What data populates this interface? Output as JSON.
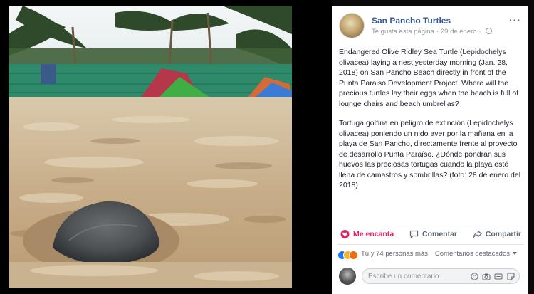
{
  "post": {
    "page_name": "San Pancho Turtles",
    "liked_page": "Te gusta esta página",
    "separator": "·",
    "date": "29 de enero",
    "more_label": "···",
    "text_en": "Endangered Olive Ridley Sea Turtle (Lepidochelys olivacea) laying a nest yesterday morning (Jan. 28, 2018) on San Pancho Beach directly in front of the Punta Paraiso Development Project. Where will the precious turtles lay their eggs when the beach is full of lounge chairs and beach umbrellas?",
    "text_es": "Tortuga golfina en peligro de extinción (Lepidochelys olivacea) poniendo un nido ayer por la mañana en la playa de San Pancho, directamente frente al proyecto de desarrollo Punta Paraíso. ¿Dónde pondrán sus huevos las preciosas tortugas cuando la playa esté llena de camastros y sombrillas? (foto: 28 de enero del 2018)"
  },
  "actions": {
    "like": "Me encanta",
    "comment": "Comentar",
    "share": "Compartir"
  },
  "reactions": {
    "summary": "Tú y 74 personas más",
    "sort_label": "Comentarios destacados"
  },
  "composer": {
    "placeholder": "Escribe un comentario..."
  },
  "colors": {
    "link": "#365899",
    "love": "#e0245e",
    "like_reaction": "#1877f2",
    "sad_reaction": "#f7b125",
    "angry_reaction": "#e9710f"
  },
  "icons": [
    "globe-icon",
    "more-icon",
    "heart-icon",
    "comment-icon",
    "share-icon",
    "like-reaction-icon",
    "sad-reaction-icon",
    "angry-reaction-icon",
    "emoji-icon",
    "camera-icon",
    "gif-icon",
    "sticker-icon"
  ]
}
